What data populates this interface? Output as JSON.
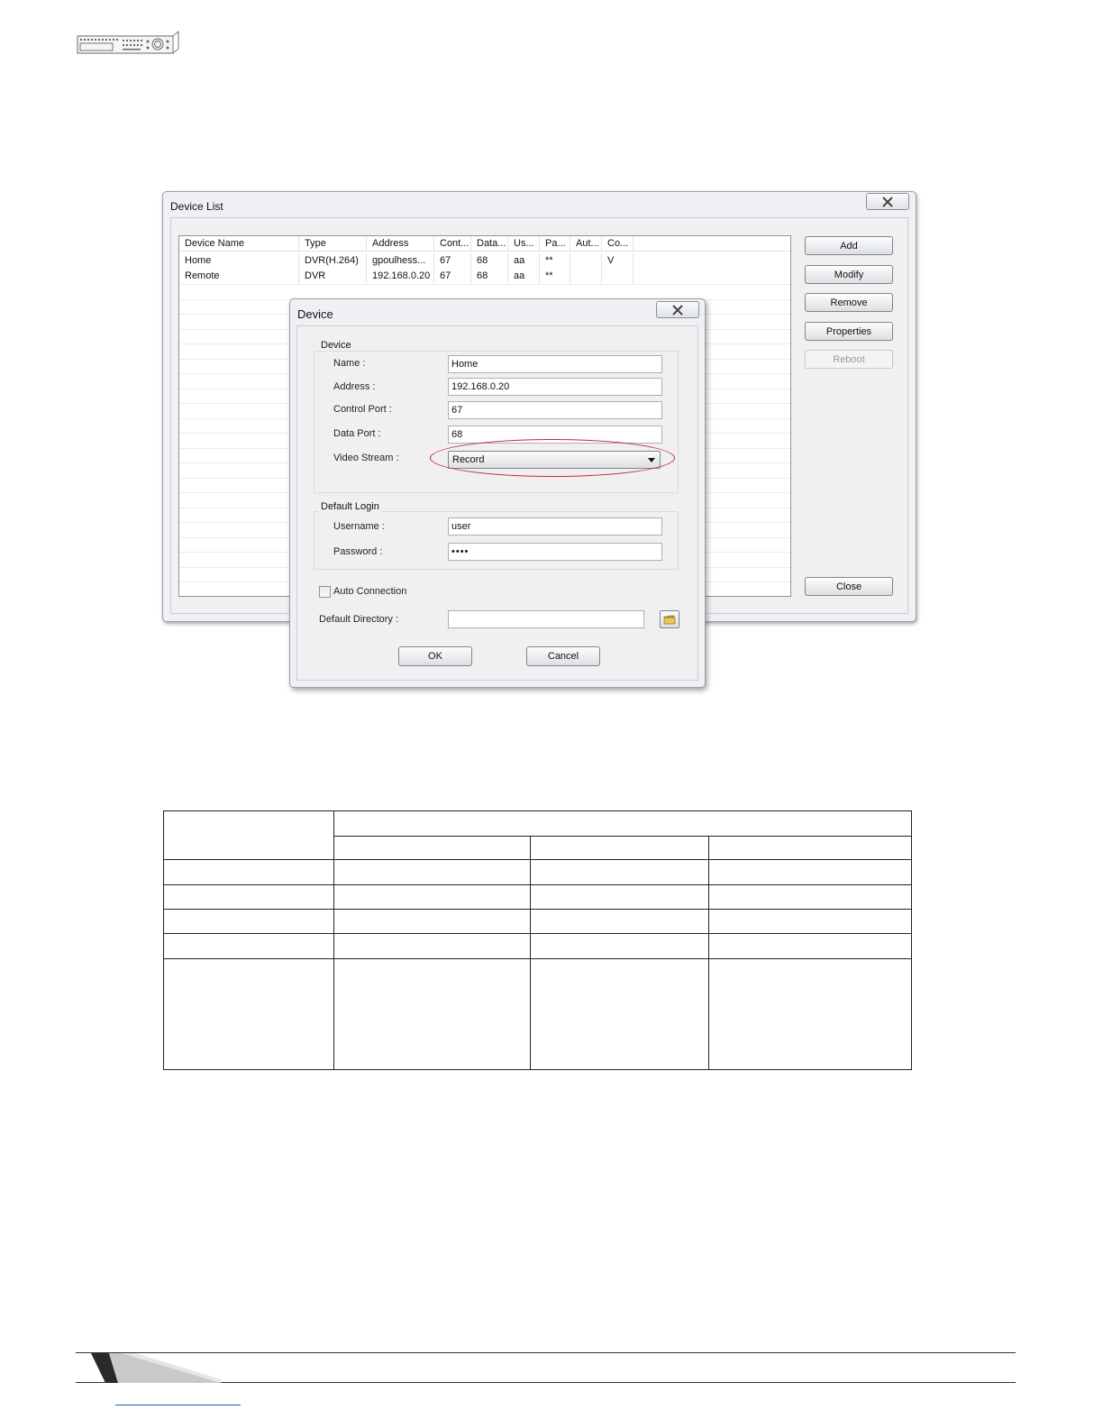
{
  "device_list": {
    "title": "Device List",
    "columns": [
      "Device Name",
      "Type",
      "Address",
      "Cont...",
      "Data...",
      "Us...",
      "Pa...",
      "Aut...",
      "Co..."
    ],
    "rows": [
      [
        "Home",
        "DVR(H.264)",
        "gpoulhess...",
        "67",
        "68",
        "aa",
        "**",
        "",
        "V"
      ],
      [
        "Remote",
        "DVR",
        "192.168.0.20",
        "67",
        "68",
        "aa",
        "**",
        "",
        ""
      ]
    ],
    "buttons": {
      "add": "Add",
      "modify": "Modify",
      "remove": "Remove",
      "properties": "Properties",
      "reboot": "Reboot",
      "close": "Close"
    }
  },
  "device_dialog": {
    "title": "Device",
    "device_group": {
      "label": "Device",
      "name_label": "Name :",
      "name_value": "Home",
      "address_label": "Address :",
      "address_value": "192.168.0.20",
      "control_port_label": "Control Port :",
      "control_port_value": "67",
      "data_port_label": "Data Port :",
      "data_port_value": "68",
      "video_stream_label": "Video Stream :",
      "video_stream_value": "Record"
    },
    "login_group": {
      "label": "Default Login",
      "username_label": "Username :",
      "username_value": "user",
      "password_label": "Password :",
      "password_value": "••••"
    },
    "auto_connection_label": "Auto Connection",
    "default_directory_label": "Default Directory :",
    "default_directory_value": "",
    "ok": "OK",
    "cancel": "Cancel"
  },
  "colors": {
    "highlight": "#c2282e",
    "window_bg": "#eef0f3"
  }
}
